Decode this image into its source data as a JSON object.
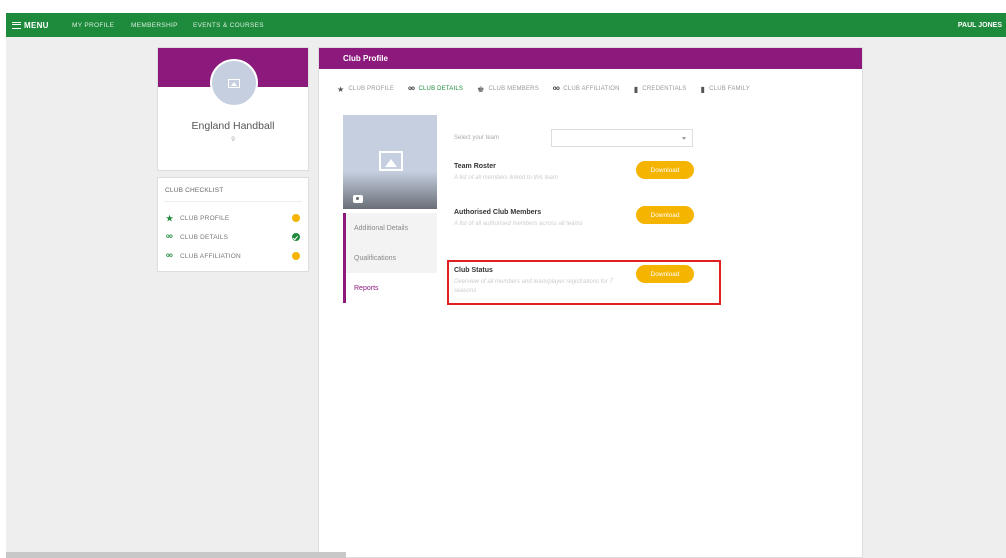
{
  "topbar": {
    "menu_label": "MENU",
    "nav": [
      "MY PROFILE",
      "MEMBERSHIP",
      "EVENTS & COURSES"
    ],
    "user": "PAUL JONES"
  },
  "profile": {
    "club_name": "England Handball",
    "sub": "9"
  },
  "checklist": {
    "title": "CLUB CHECKLIST",
    "items": [
      {
        "label": "CLUB PROFILE",
        "icon": "star-icon",
        "status": "pending"
      },
      {
        "label": "CLUB DETAILS",
        "icon": "glasses-icon",
        "status": "complete"
      },
      {
        "label": "CLUB AFFILIATION",
        "icon": "glasses-icon",
        "status": "pending"
      }
    ]
  },
  "main": {
    "title": "Club Profile",
    "tabs": [
      {
        "label": "CLUB PROFILE",
        "icon": "star-icon",
        "active": false
      },
      {
        "label": "CLUB DETAILS",
        "icon": "glasses-icon",
        "active": true
      },
      {
        "label": "CLUB MEMBERS",
        "icon": "people-icon",
        "active": false
      },
      {
        "label": "CLUB AFFILIATION",
        "icon": "glasses-icon",
        "active": false
      },
      {
        "label": "CREDENTIALS",
        "icon": "bookmark-icon",
        "active": false
      },
      {
        "label": "CLUB FAMILY",
        "icon": "bookmark-icon",
        "active": false
      }
    ],
    "side_menu": [
      {
        "label": "Additional Details",
        "active": false
      },
      {
        "label": "Qualifications",
        "active": false
      },
      {
        "label": "Reports",
        "active": true
      }
    ],
    "team_select": {
      "label": "Select your team",
      "value": ""
    },
    "reports": [
      {
        "title": "Team Roster",
        "desc": "A list of all members linked to this team",
        "button": "Download"
      },
      {
        "title": "Authorised Club Members",
        "desc": "A list of all authorised members across all teams",
        "button": "Download"
      },
      {
        "title": "Club Status",
        "desc": "Overview of all members and team/player registrations for 7 seasons",
        "button": "Download"
      }
    ]
  },
  "colors": {
    "brand_green": "#1e8a3c",
    "brand_purple": "#8b1a7c",
    "button_yellow": "#f5b400",
    "highlight_red": "#e02020"
  }
}
